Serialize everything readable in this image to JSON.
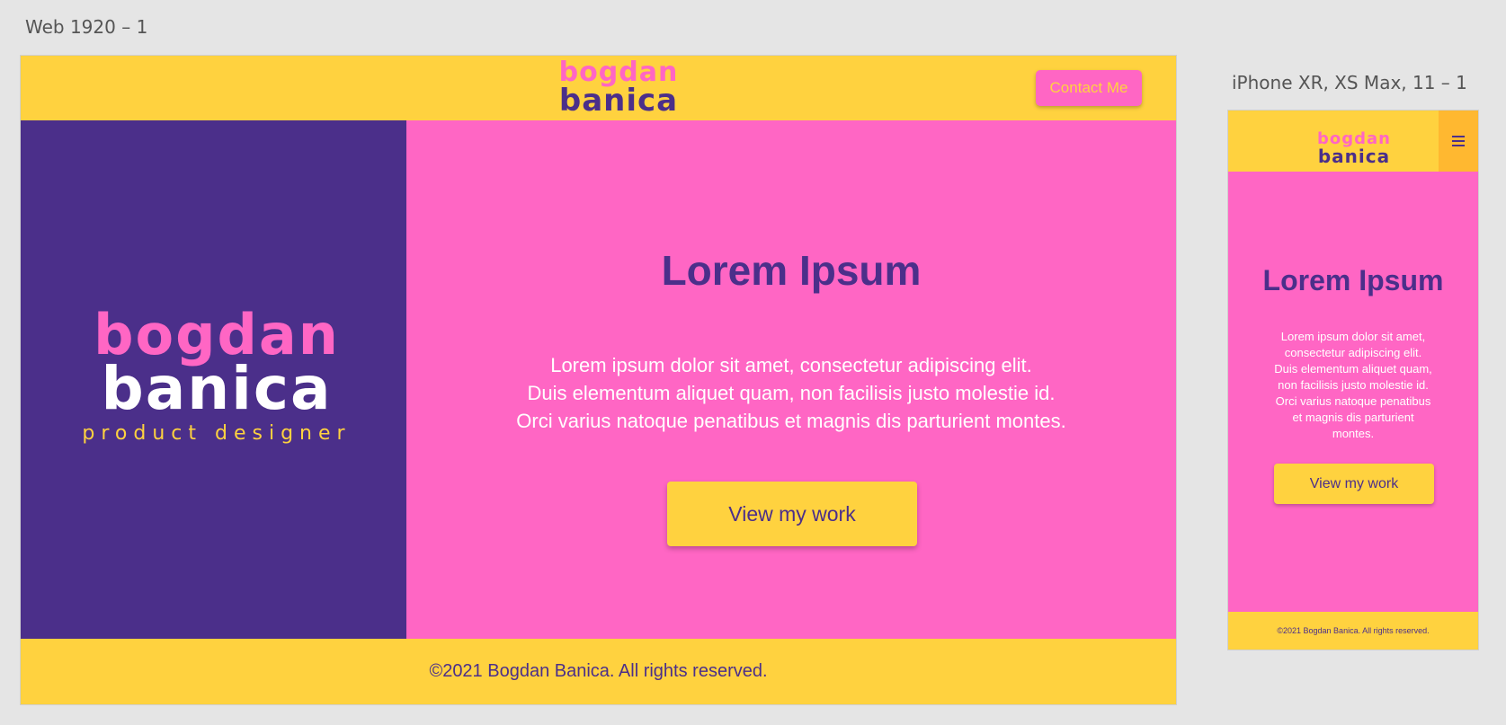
{
  "canvas": {
    "web_artboard_label": "Web 1920 – 1",
    "mobile_artboard_label": "iPhone XR, XS Max, 11 – 1"
  },
  "colors": {
    "yellow": "#ffd23f",
    "pink": "#ff66c4",
    "purple": "#4b2f8a",
    "orange": "#ffb830",
    "white": "#ffffff"
  },
  "web": {
    "header": {
      "logo_line1": "bogdan",
      "logo_line2": "banica",
      "contact_label": "Contact Me"
    },
    "hero_logo": {
      "line1": "bogdan",
      "line2": "banica",
      "tagline": "product designer"
    },
    "main": {
      "title": "Lorem Ipsum",
      "body_lines": [
        "Lorem ipsum dolor sit amet, consectetur adipiscing elit.",
        "Duis elementum aliquet quam, non facilisis justo molestie id.",
        "Orci varius natoque penatibus et magnis dis parturient montes."
      ],
      "cta_label": "View my work"
    },
    "footer": {
      "text": "©2021 Bogdan Banica. All rights reserved."
    }
  },
  "mobile": {
    "header": {
      "logo_line1": "bogdan",
      "logo_line2": "banica",
      "menu_icon": "hamburger-menu-icon"
    },
    "main": {
      "title": "Lorem Ipsum",
      "body": "Lorem ipsum dolor sit amet, consectetur adipiscing elit. Duis elementum aliquet quam, non facilisis justo molestie id. Orci varius natoque penatibus et magnis dis parturient montes.",
      "cta_label": "View my work"
    },
    "footer": {
      "text": "©2021 Bogdan Banica. All rights reserved."
    }
  }
}
